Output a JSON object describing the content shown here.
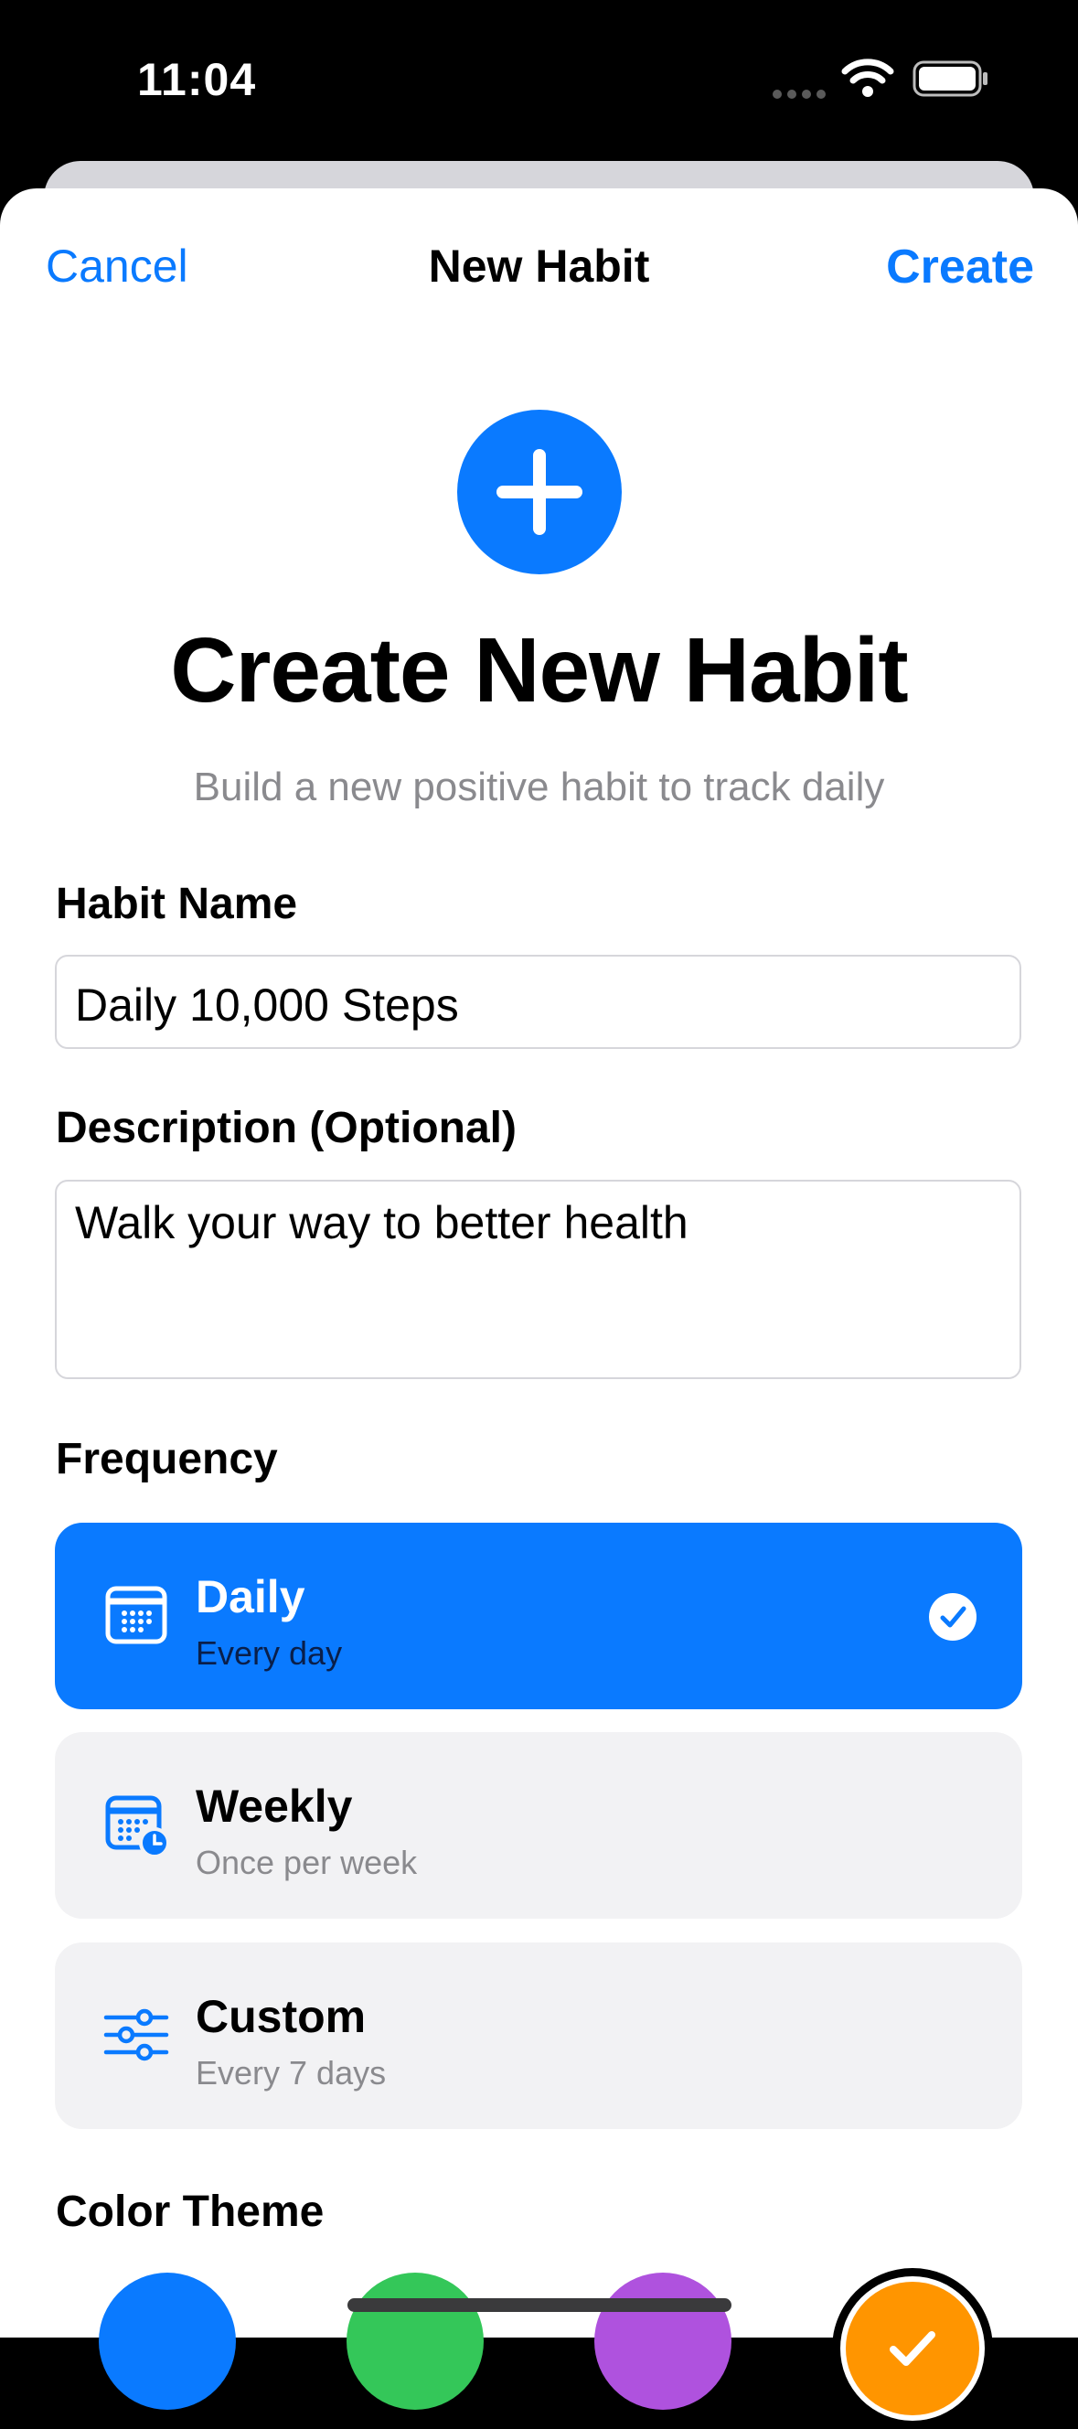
{
  "status_bar": {
    "time": "11:04"
  },
  "nav": {
    "cancel_label": "Cancel",
    "title": "New Habit",
    "create_label": "Create"
  },
  "hero": {
    "icon": "plus-icon",
    "title": "Create New Habit",
    "subtitle": "Build a new positive habit to track daily"
  },
  "form": {
    "habit_name_label": "Habit Name",
    "habit_name_value": "Daily 10,000 Steps",
    "description_label": "Description (Optional)",
    "description_value": "Walk your way to better health",
    "frequency_label": "Frequency",
    "frequency_options": [
      {
        "title": "Daily",
        "subtitle": "Every day",
        "icon": "calendar-icon",
        "selected": true
      },
      {
        "title": "Weekly",
        "subtitle": "Once per week",
        "icon": "calendar-clock-icon",
        "selected": false
      },
      {
        "title": "Custom",
        "subtitle": "Every 7 days",
        "icon": "sliders-icon",
        "selected": false
      }
    ],
    "color_theme_label": "Color Theme",
    "color_options": [
      "#0a7aff",
      "#34c759",
      "#af52de",
      "#ff9500"
    ],
    "selected_color": "#ff9500"
  },
  "colors": {
    "accent": "#0a7aff",
    "secondary_text": "#8a8a8e"
  }
}
